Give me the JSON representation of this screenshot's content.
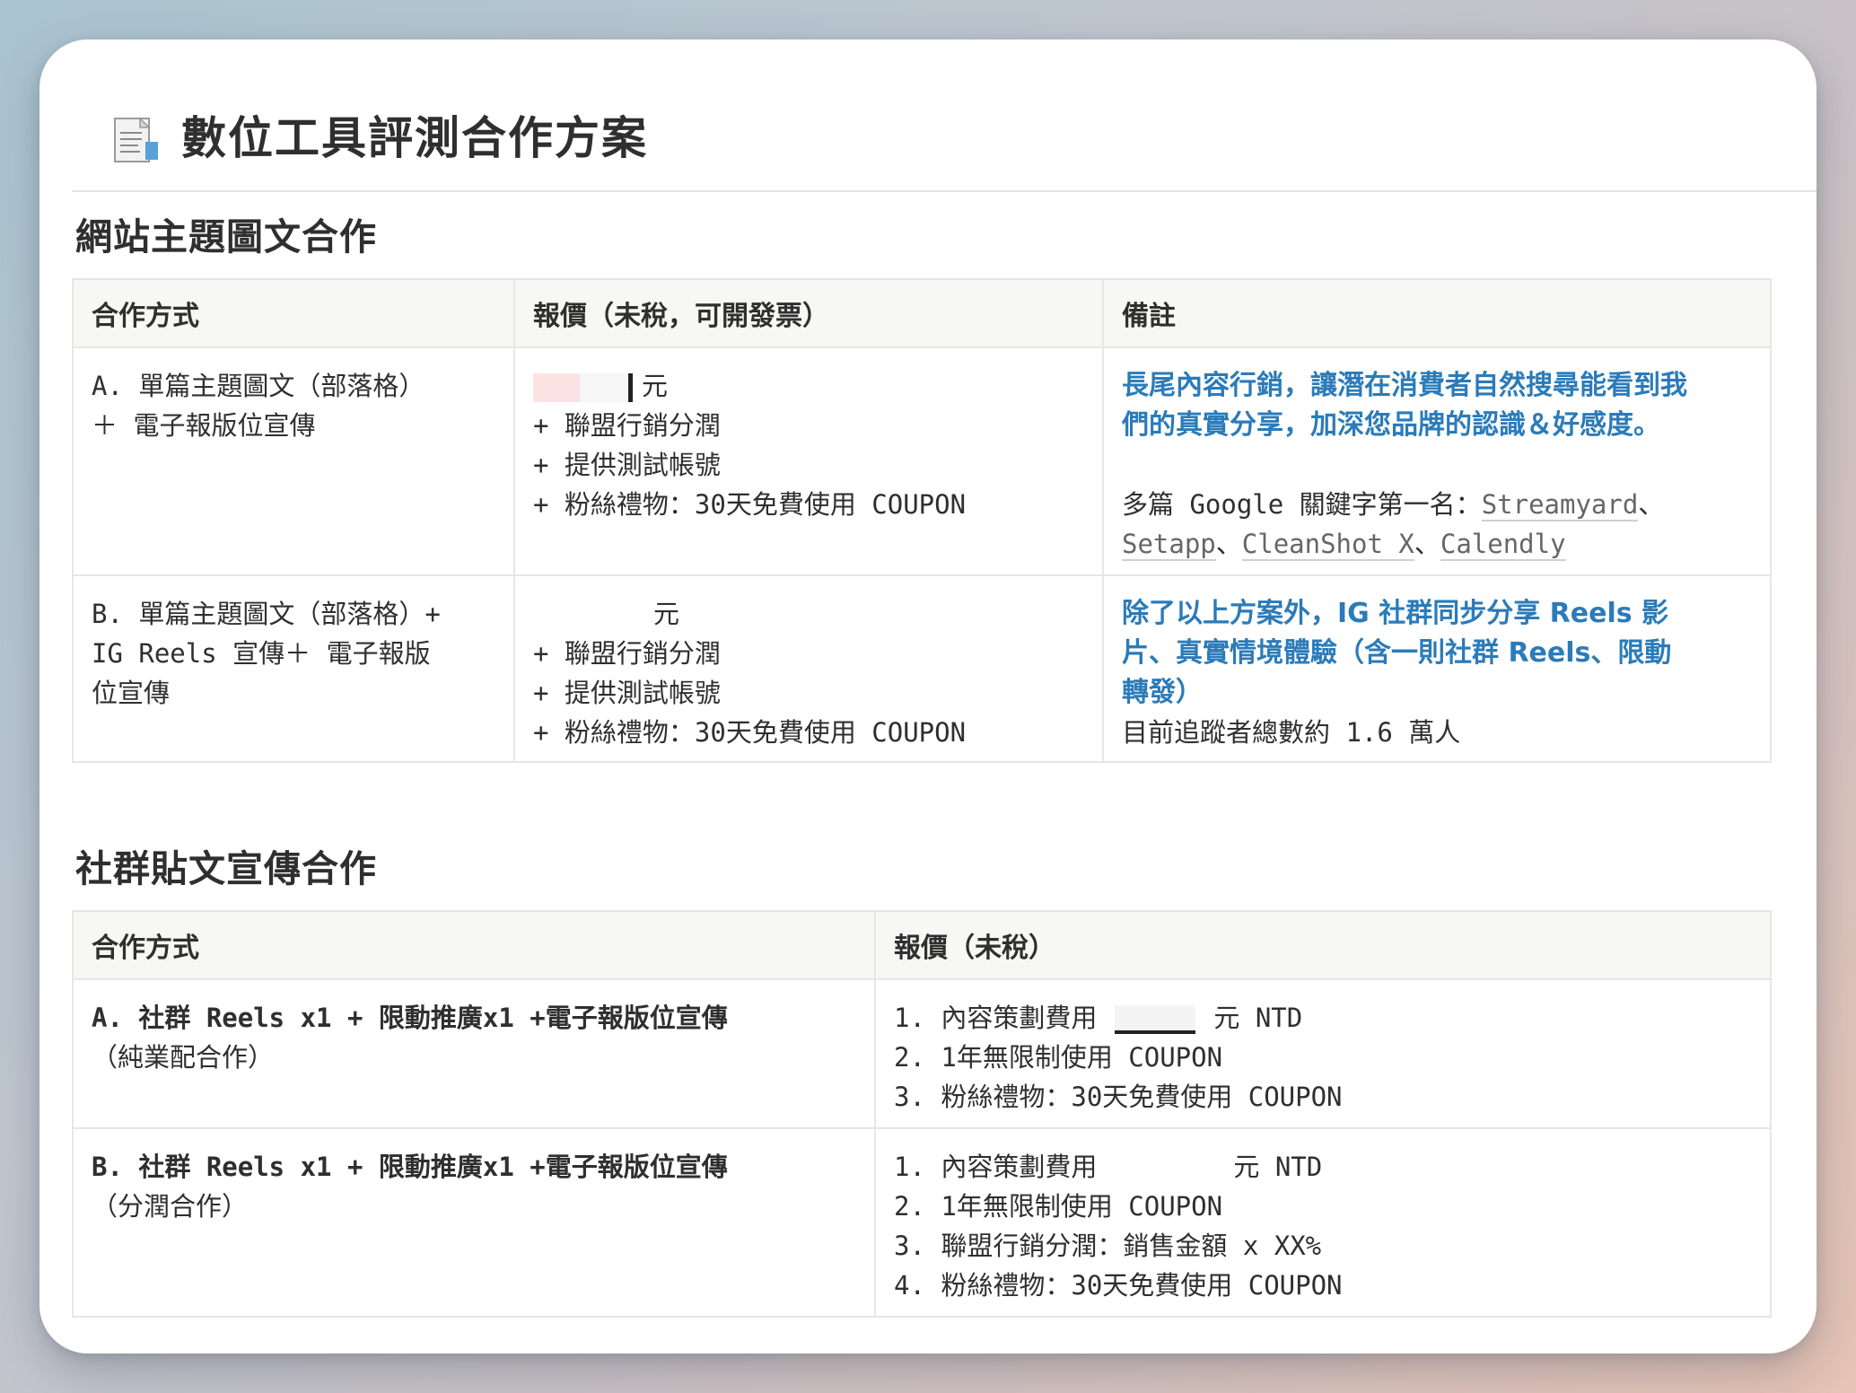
{
  "page": {
    "title": "數位工具評測合作方案",
    "icon": "document-icon"
  },
  "section1": {
    "title": "網站主題圖文合作",
    "headers": [
      "合作方式",
      "報價（未稅，可開發票）",
      "備註"
    ],
    "rowA": {
      "method": [
        "A. 單篇主題圖文（部落格）",
        "＋ 電子報版位宣傳"
      ],
      "price_unit": "元",
      "price_items": [
        "+ 聯盟行銷分潤",
        "+ 提供測試帳號",
        "+ 粉絲禮物：30天免費使用 COUPON"
      ],
      "note_highlight": [
        "長尾內容行銷，讓潛在消費者自然搜尋能看到我",
        "們的真實分享，加深您品牌的認識＆好感度。"
      ],
      "note_prefix": "多篇 Google 關鍵字第一名：",
      "links": [
        "Streamyard",
        "Setapp",
        "CleanShot X",
        "Calendly"
      ]
    },
    "rowB": {
      "method": [
        "B. 單篇主題圖文（部落格）+",
        "IG Reels 宣傳＋ 電子報版",
        "位宣傳"
      ],
      "price_unit": "元",
      "price_items": [
        "+ 聯盟行銷分潤",
        "+ 提供測試帳號",
        "+ 粉絲禮物：30天免費使用 COUPON"
      ],
      "note_highlight": [
        "除了以上方案外，IG 社群同步分享 Reels 影",
        "片、真實情境體驗（含一則社群 Reels、限動",
        "轉發）"
      ],
      "note_plain": "目前追蹤者總數約 1.6 萬人"
    }
  },
  "section2": {
    "title": "社群貼文宣傳合作",
    "headers": [
      "合作方式",
      "報價（未稅）"
    ],
    "rowA": {
      "method_title": "A. 社群 Reels x1 + 限動推廣x1 +電子報版位宣傳",
      "method_sub": "（純業配合作）",
      "item1_label": "1. 內容策劃費用",
      "item1_unit": "元 NTD",
      "items": [
        "2. 1年無限制使用 COUPON",
        "3. 粉絲禮物：30天免費使用 COUPON"
      ]
    },
    "rowB": {
      "method_title": "B. 社群 Reels x1 + 限動推廣x1 +電子報版位宣傳",
      "method_sub": "（分潤合作）",
      "item1_label": "1. 內容策劃費用",
      "item1_unit": "元 NTD",
      "items": [
        "2. 1年無限制使用 COUPON",
        "3. 聯盟行銷分潤：銷售金額 x XX%",
        "4. 粉絲禮物：30天免費使用 COUPON"
      ]
    }
  },
  "colors": {
    "highlight_blue": "#2b7bb9",
    "text": "#2f2f2f",
    "border": "#e6e6e4",
    "header_bg": "#f7f7f5"
  }
}
